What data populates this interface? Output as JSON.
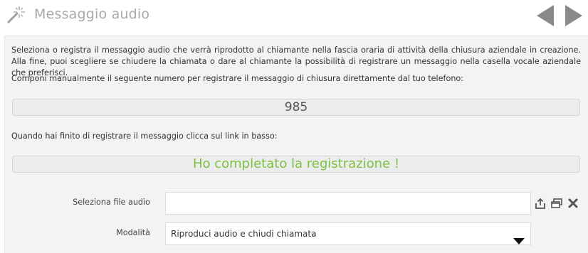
{
  "header": {
    "title": "Messaggio audio",
    "icons": {
      "left": "magic-wand-icon",
      "prev": "arrow-left-icon",
      "next": "arrow-right-icon"
    }
  },
  "content": {
    "intro": "Seleziona o registra il messaggio audio che verrà riprodotto al chiamante nella fascia oraria di attività della chiusura aziendale in creazione. Alla fine, puoi scegliere se chiudere la chiamata o dare al chiamante la possibilità di registrare un messaggio nella casella vocale aziendale che preferisci.",
    "dial_instruction": "Componi manualmente il seguente numero per registrare il messaggio di chiusura direttamente dal tuo telefono:",
    "dial_number": "985",
    "finish_instruction": "Quando hai finito di registrare il messaggio clicca sul link in basso:",
    "done_link": "Ho completato la registrazione !"
  },
  "form": {
    "file_label": "Seleziona file audio",
    "file_value": "",
    "file_actions": [
      "upload-icon",
      "open-window-icon",
      "clear-icon"
    ],
    "mode_label": "Modalità",
    "mode_selected": "Riproduci audio e chiudi chiamata"
  },
  "colors": {
    "title": "#a9a9a9",
    "panel_bg": "#f3f3f3",
    "accent_green": "#7cc242",
    "nav_arrow": "#8a8a8a"
  }
}
